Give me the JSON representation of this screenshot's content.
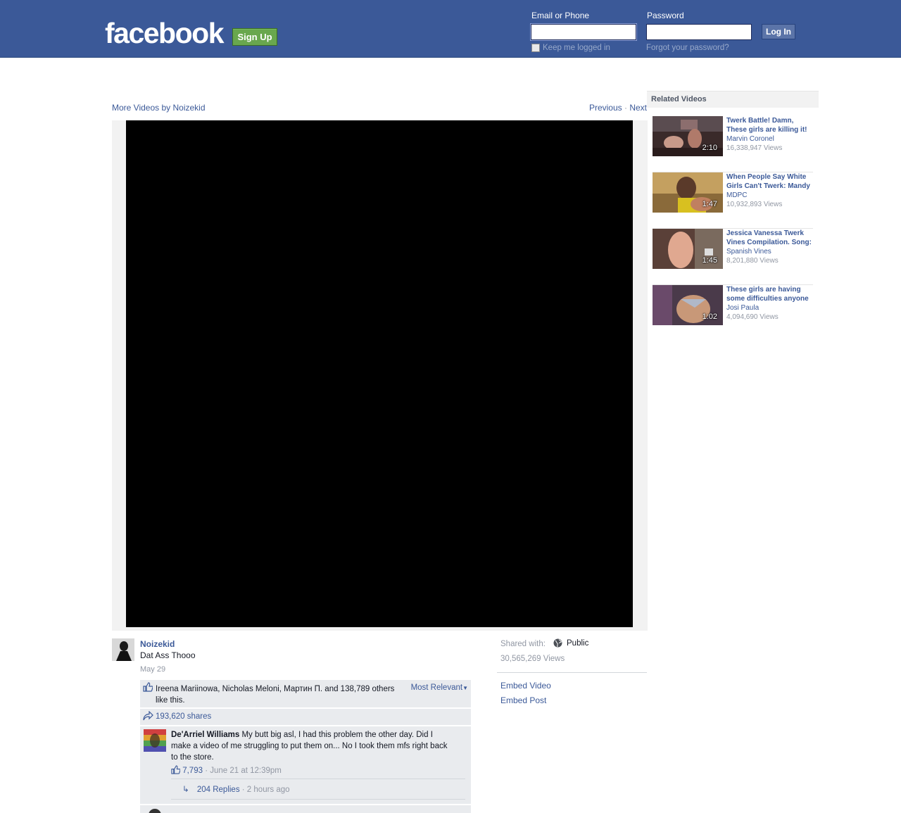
{
  "header": {
    "logo": "facebook",
    "signup_label": "Sign Up",
    "email_label": "Email or Phone",
    "email_value": "",
    "password_label": "Password",
    "password_value": "",
    "login_label": "Log In",
    "keep_logged_in": "Keep me logged in",
    "forgot_password": "Forgot your password?"
  },
  "video": {
    "more_videos": "More Videos by Noizekid",
    "previous": "Previous",
    "separator": "·",
    "next": "Next"
  },
  "related": {
    "header": "Related Videos",
    "items": [
      {
        "title": "Twerk Battle! Damn, These girls are killing it!",
        "author": "Marvin Coronel",
        "views": "16,338,947 Views",
        "duration": "2:10",
        "thumb_color": "#6b3a3a"
      },
      {
        "title": "When People Say White Girls Can't Twerk: Mandy",
        "author": "MDPC",
        "views": "10,932,893 Views",
        "duration": "1:47",
        "thumb_color": "#b08a2a"
      },
      {
        "title": "Jessica Vanessa Twerk Vines Compilation. Song:",
        "author": "Spanish Vines",
        "views": "8,201,880 Views",
        "duration": "1:45",
        "thumb_color": "#a07060"
      },
      {
        "title": "These girls are having some difficulties anyone",
        "author": "Josi Paula",
        "views": "4,094,690 Views",
        "duration": "1:02",
        "thumb_color": "#7a6a7a"
      }
    ]
  },
  "post": {
    "author": "Noizekid",
    "text": "Dat Ass Thooo",
    "date": "May 29",
    "likes_text": "Ireena Mariinowa, Nicholas Meloni, Мартин П. and 138,789 others like this.",
    "sort_label": "Most Relevant",
    "shares": "193,620 shares",
    "shared_with_label": "Shared with:",
    "privacy": "Public",
    "views": "30,565,269 Views",
    "embed_video": "Embed Video",
    "embed_post": "Embed Post"
  },
  "comments": [
    {
      "author": "De'Arriel Williams",
      "text": "My butt big asl, I had this problem the other day. Did I make a video of me struggling to put them on... No I took them mfs right back to the store.",
      "likes": "7,793",
      "time": "· June 21 at 12:39pm",
      "replies": "204 Replies",
      "replies_time": "· 2 hours ago"
    }
  ],
  "colors": {
    "brand": "#3b5998",
    "signup": "#69a74e",
    "panel": "#e9ebee"
  }
}
